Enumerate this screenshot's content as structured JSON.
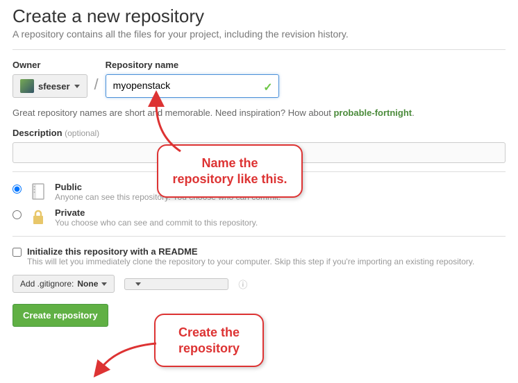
{
  "heading": "Create a new repository",
  "subtitle": "A repository contains all the files for your project, including the revision history.",
  "owner": {
    "label": "Owner",
    "name": "sfeeser"
  },
  "repo": {
    "label": "Repository name",
    "value": "myopenstack"
  },
  "hint_prefix": "Great repository names are short and memorable. Need inspiration? How about ",
  "hint_suggest": "probable-fortnight",
  "description": {
    "label": "Description",
    "optional": "(optional)",
    "value": ""
  },
  "visibility": {
    "public": {
      "title": "Public",
      "sub": "Anyone can see this repository. You choose who can commit."
    },
    "private": {
      "title": "Private",
      "sub": "You choose who can see and commit to this repository."
    }
  },
  "init": {
    "title": "Initialize this repository with a README",
    "sub": "This will let you immediately clone the repository to your computer. Skip this step if you're importing an existing repository."
  },
  "gitignore": {
    "prefix": "Add .gitignore: ",
    "value": "None"
  },
  "license_hidden": "",
  "create_label": "Create repository",
  "callout1": "Name the repository like this.",
  "callout2": "Create the repository"
}
